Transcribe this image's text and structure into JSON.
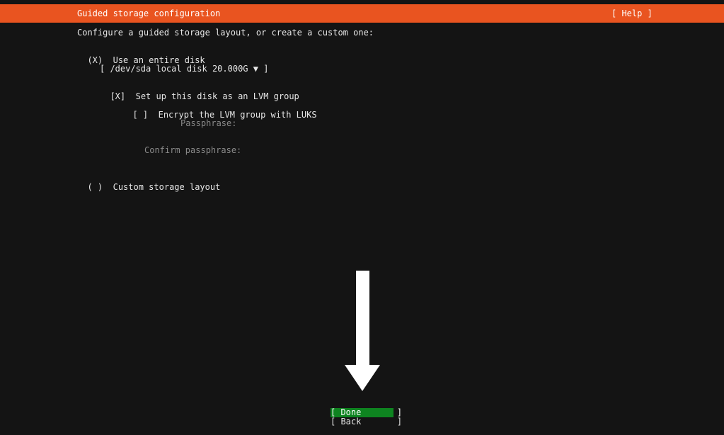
{
  "header": {
    "title": "Guided storage configuration",
    "help_label": "[ Help ]",
    "accent_color": "#e95420"
  },
  "main": {
    "intro": "Configure a guided storage layout, or create a custom one:",
    "use_entire_disk": {
      "marker": "(X)",
      "label": "Use an entire disk"
    },
    "disk_select": {
      "value": "[ /dev/sda local disk 20.000G ▼ ]"
    },
    "lvm": {
      "marker": "[X]",
      "label": "Set up this disk as an LVM group"
    },
    "encrypt": {
      "marker": "[ ]",
      "label": "Encrypt the LVM group with LUKS"
    },
    "passphrase_label": "Passphrase:",
    "confirm_passphrase_label": "Confirm passphrase:",
    "custom_layout": {
      "marker": "( )",
      "label": "Custom storage layout"
    }
  },
  "footer": {
    "done_label": "[ Done       ]",
    "back_label": "[ Back       ]",
    "done_color": "#0e8420"
  },
  "overlay": {
    "icon": "down-arrow-icon"
  }
}
